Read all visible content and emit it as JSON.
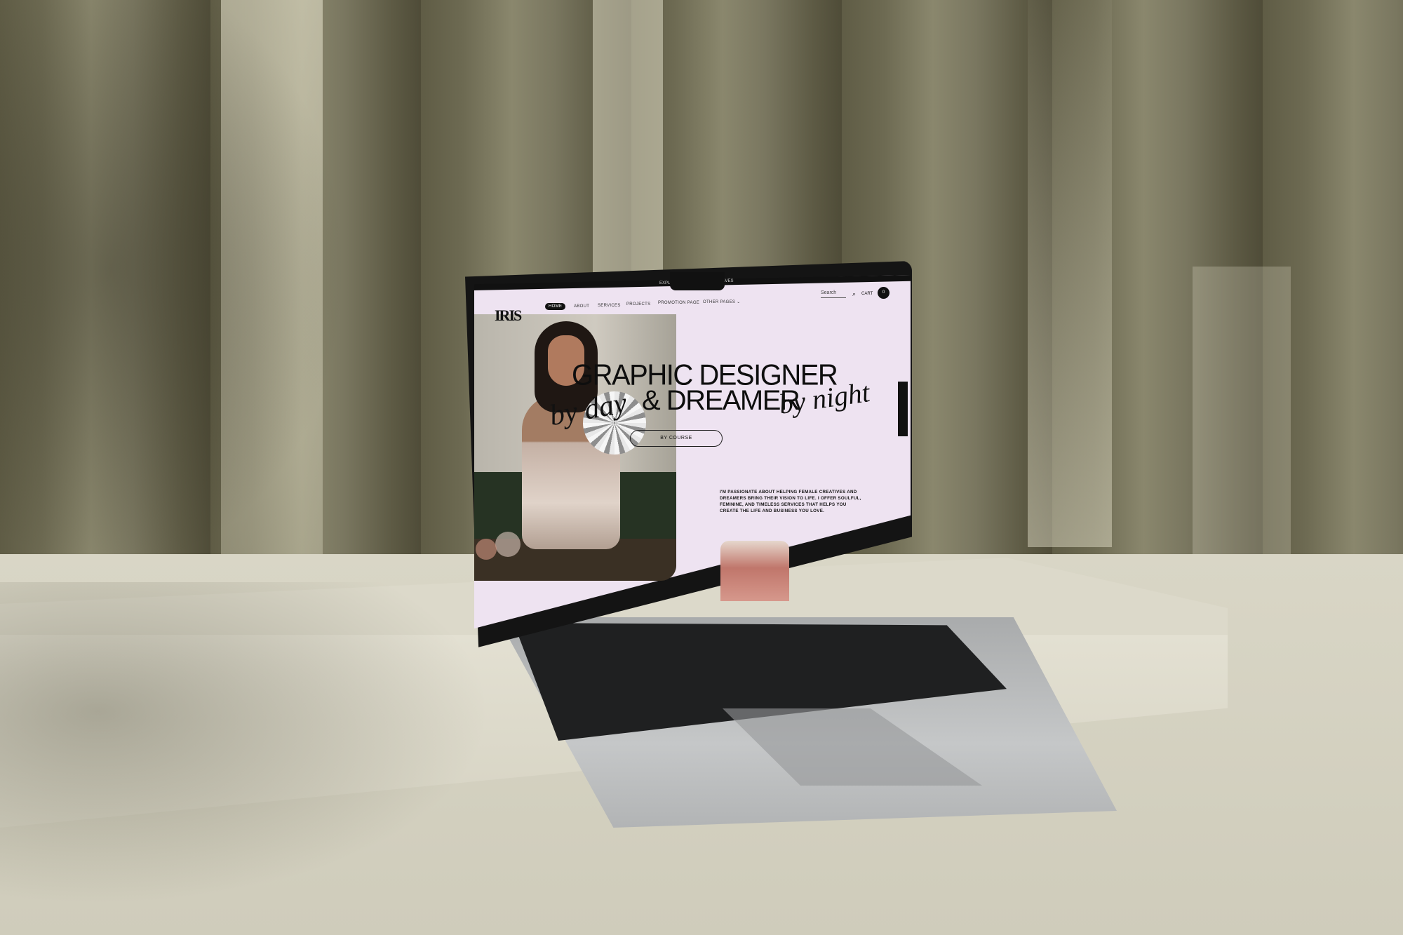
{
  "site": {
    "logo": "IRIS",
    "topbar_left": "EXPLO",
    "topbar_right": "AVES",
    "nav": [
      "HOME",
      "ABOUT",
      "SERVICES",
      "PROJECTS",
      "PROMOTION PAGE",
      "OTHER PAGES"
    ],
    "search_placeholder": "Search",
    "cart_label": "CART",
    "cart_count": "0",
    "hero_line1": "GRAPHIC DESIGNER",
    "hero_line2": "& DREAMER",
    "script_left": "by day",
    "script_right": "by night",
    "cta": "BY COURSE",
    "blurb": "I'M PASSIONATE ABOUT HELPING FEMALE CREATIVES AND DREAMERS BRING THEIR VISION TO LIFE. I OFFER SOULFUL, FEMININE, AND TIMELESS SERVICES THAT HELPS YOU CREATE THE LIFE AND BUSINESS YOU LOVE."
  },
  "colors": {
    "screen_bg": "#eee3f1",
    "text": "#0e0e0e",
    "curtain": "#6d6a52",
    "floor": "#d9d6c6"
  },
  "icons": [
    "search-icon",
    "chevron-down-icon"
  ]
}
